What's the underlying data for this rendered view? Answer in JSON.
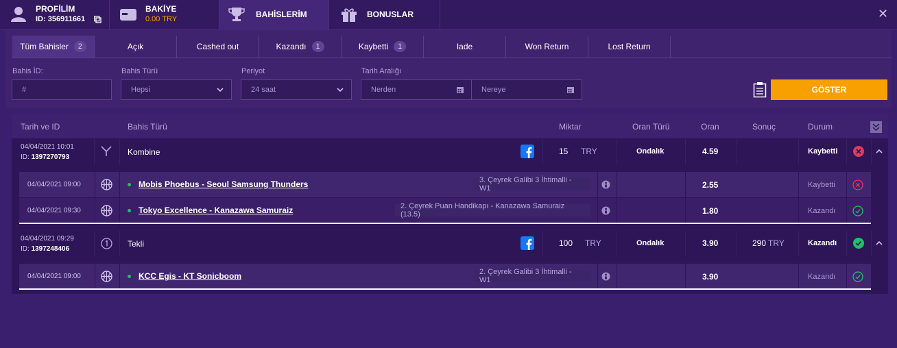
{
  "nav": {
    "profile": {
      "title": "PROFİLİM",
      "id": "ID: 356911661"
    },
    "balance": {
      "title": "BAKİYE",
      "amount": "0.00 TRY"
    },
    "bets": {
      "title": "BAHİSLERİM"
    },
    "bonus": {
      "title": "BONUSLAR"
    }
  },
  "tabs": [
    {
      "label": "Tüm Bahisler",
      "count": "2"
    },
    {
      "label": "Açık"
    },
    {
      "label": "Cashed out"
    },
    {
      "label": "Kazandı",
      "count": "1"
    },
    {
      "label": "Kaybetti",
      "count": "1"
    },
    {
      "label": "Iade"
    },
    {
      "label": "Won Return"
    },
    {
      "label": "Lost Return"
    }
  ],
  "filters": {
    "bet_id": {
      "label": "Bahis İD:",
      "placeholder": "#"
    },
    "bet_type": {
      "label": "Bahis Türü",
      "value": "Hepsi"
    },
    "period": {
      "label": "Periyot",
      "value": "24 saat"
    },
    "date_range": {
      "label": "Tarih Aralığı",
      "from": "Nerden",
      "to": "Nereye"
    },
    "show_button": "GÖSTER"
  },
  "table": {
    "headers": {
      "date": "Tarih ve ID",
      "type": "Bahis Türü",
      "amount": "Miktar",
      "odds_type": "Oran Türü",
      "odds": "Oran",
      "result": "Sonuç",
      "status": "Durum"
    },
    "bets": [
      {
        "date": "04/04/2021 10:01",
        "id_label": "ID:",
        "id": "1397270793",
        "type": "Kombine",
        "amount": "15",
        "currency": "TRY",
        "odds_type": "Ondalık",
        "odds": "4.59",
        "result": "",
        "result_currency": "",
        "status": "Kaybetti",
        "selections": [
          {
            "date": "04/04/2021 09:00",
            "match": "Mobis Phoebus - Seoul Samsung Thunders",
            "market": "3. Çeyrek Galibi 3 İhtimalli - W1",
            "odds": "2.55",
            "status": "Kaybetti"
          },
          {
            "date": "04/04/2021 09:30",
            "match": "Tokyo Excellence - Kanazawa Samuraiz",
            "market": "2. Çeyrek Puan Handikapı - Kanazawa Samuraiz (13.5)",
            "odds": "1.80",
            "status": "Kazandı"
          }
        ]
      },
      {
        "date": "04/04/2021 09:29",
        "id_label": "ID:",
        "id": "1397248406",
        "type": "Tekli",
        "amount": "100",
        "currency": "TRY",
        "odds_type": "Ondalık",
        "odds": "3.90",
        "result": "290",
        "result_currency": "TRY",
        "status": "Kazandı",
        "selections": [
          {
            "date": "04/04/2021 09:00",
            "match": "KCC Egis - KT Sonicboom",
            "market": "2. Çeyrek Galibi 3 İhtimalli - W1",
            "odds": "3.90",
            "status": "Kazandı"
          }
        ]
      }
    ]
  },
  "colors": {
    "accent": "#f7a000",
    "won": "#22c064",
    "lost": "#e23a5a",
    "bg": "#3a1f6e"
  }
}
